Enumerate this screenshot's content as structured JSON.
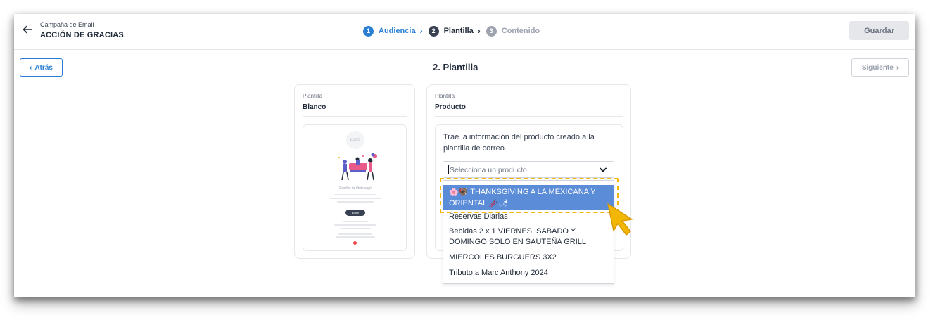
{
  "header": {
    "subtitle": "Campaña de Email",
    "title": "ACCIÓN DE GRACIAS",
    "save_label": "Guardar"
  },
  "steps": [
    {
      "number": "1",
      "label": "Audiencia",
      "chevron": "›",
      "state": "done",
      "color": "#2a7fd4"
    },
    {
      "number": "2",
      "label": "Plantilla",
      "chevron": "›",
      "state": "current",
      "color": "#374151"
    },
    {
      "number": "3",
      "label": "Contenido",
      "state": "pending",
      "color": "#9ca3af"
    }
  ],
  "nav": {
    "back_label": "Atrás",
    "back_chevron": "‹",
    "section_title": "2. Plantilla",
    "next_label": "Siguiente",
    "next_chevron": "›"
  },
  "templates": [
    {
      "kicker": "Plantilla",
      "name": "Blanco",
      "preview": {
        "logo_text": "LOGO",
        "heading": "Escribe tu título aquí",
        "button": "Botón"
      }
    },
    {
      "kicker": "Plantilla",
      "name": "Producto",
      "description": "Trae la información del producto creado a la plantilla de correo.",
      "select_placeholder": "Selecciona un producto",
      "options": [
        {
          "emoji_before": "🌸🦃",
          "label": "THANKSGIVING A LA MEXICANA Y ORIENTAL",
          "emoji_after": "🥢🌶",
          "highlighted": true
        },
        {
          "label": "Reservas Diarias"
        },
        {
          "label": "Bebidas 2 x 1 VIERNES, SABADO Y DOMINGO SOLO EN SAUTEÑA GRILL"
        },
        {
          "label": "MIERCOLES BURGUERS 3X2"
        },
        {
          "label": "Tributo a Marc Anthony 2024"
        }
      ]
    }
  ],
  "colors": {
    "accent": "#2a7fd4",
    "highlight_option": "#5b8cd8",
    "annotation": "#f2b705"
  },
  "icons": [
    "back-arrow-icon",
    "chevron-down-icon",
    "pointer-hand-icon"
  ]
}
